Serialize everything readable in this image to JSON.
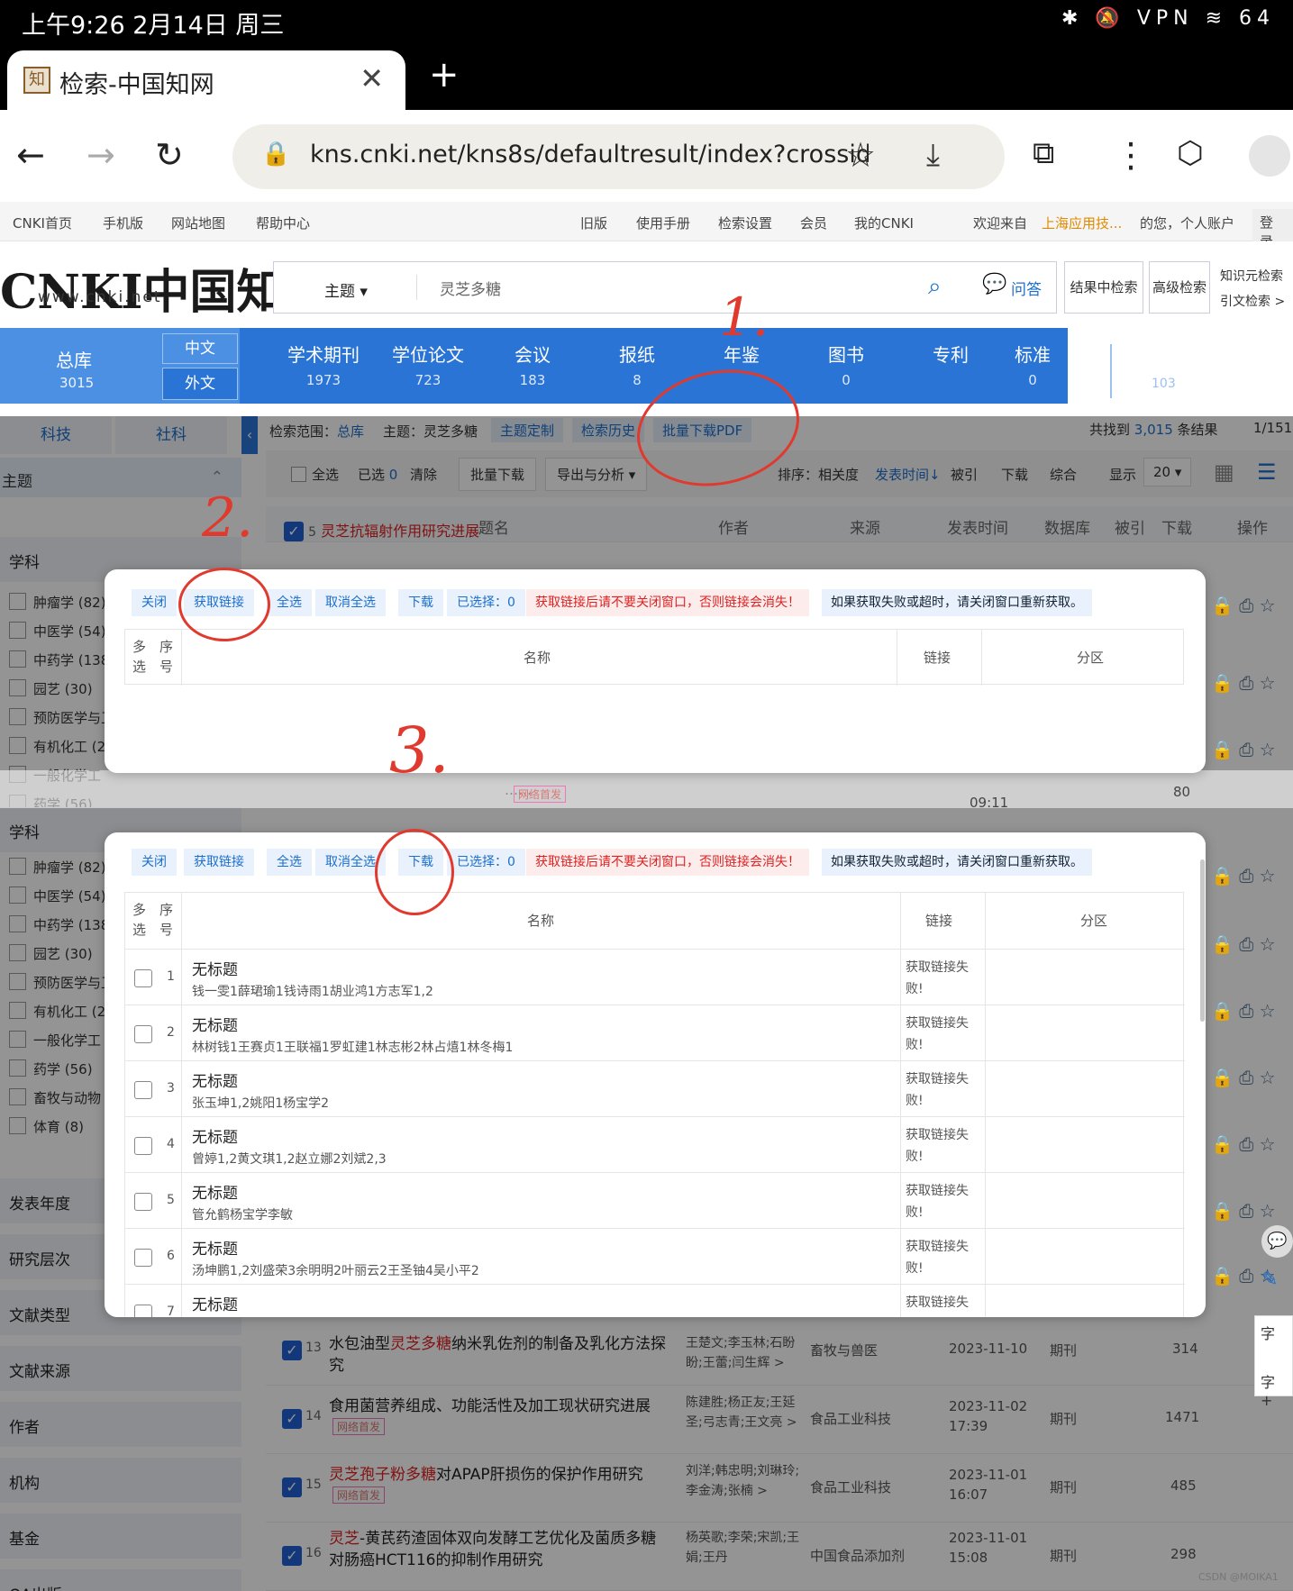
{
  "status": {
    "time": "上午9:26 2月14日 周三",
    "icons": "✱ 🔕 VPN ≋ 64"
  },
  "browser": {
    "tab_title": "检索-中国知网",
    "tab_favicon": "知",
    "url": "kns.cnki.net/kns8s/defaultresult/index?crossid"
  },
  "topnav": {
    "left": [
      "CNKI首页",
      "手机版",
      "网站地图",
      "帮助中心"
    ],
    "right": [
      "旧版",
      "使用手册",
      "检索设置",
      "会员",
      "我的CNKI"
    ],
    "welcome": "欢迎来自",
    "org": "上海应用技...",
    "account": "的您，个人账户",
    "login": "登录"
  },
  "search": {
    "logo": "CNKI中国知网",
    "logo_sub": "www.cnki.net",
    "field": "主题",
    "query": "灵芝多糖",
    "ask": "问答",
    "in_result": "结果中检索",
    "advanced": "高级检索",
    "knowledge": "知识元检索",
    "citation": "引文检索 >"
  },
  "dbtabs": {
    "all": {
      "label": "总库",
      "count": "3015",
      "cn": "中文",
      "en": "外文"
    },
    "items": [
      {
        "label": "学术期刊",
        "count": "1973"
      },
      {
        "label": "学位论文",
        "count": "723"
      },
      {
        "label": "会议",
        "count": "183"
      },
      {
        "label": "报纸",
        "count": "8"
      },
      {
        "label": "年鉴",
        "count": ""
      },
      {
        "label": "图书",
        "count": "0"
      },
      {
        "label": "专利",
        "count": ""
      },
      {
        "label": "标准",
        "count": "0"
      }
    ],
    "extra": "103"
  },
  "facets": {
    "tab1": "科技",
    "tab2": "社科",
    "topic": "主题",
    "subject": "学科",
    "subjects": [
      "肿瘤学 (82)",
      "中医学 (54)",
      "中药学 (138)",
      "园艺 (30)",
      "预防医学与卫生学",
      "有机化工 (2",
      "一般化学工",
      "药学 (56)",
      "畜牧与动物",
      "体育 (8)"
    ],
    "groups": [
      "发表年度",
      "研究层次",
      "文献类型",
      "文献来源",
      "作者",
      "机构",
      "基金",
      "OA出版"
    ]
  },
  "results": {
    "scope_label": "检索范围：",
    "scope": "总库",
    "topic_label": "主题：灵芝多糖",
    "pills": [
      "主题定制",
      "检索历史",
      "批量下载PDF"
    ],
    "found": "共找到",
    "total": "3,015",
    "found_suffix": "条结果",
    "page": "1/151",
    "selectall": "全选",
    "selected": "已选",
    "selected_n": "0",
    "clear": "清除",
    "batch": "批量下载",
    "export": "导出与分析",
    "sort": "排序：相关度",
    "sort_time": "发表时间",
    "sort_cited": "被引",
    "sort_dl": "下载",
    "sort_all": "综合",
    "show": "显示",
    "per_page": "20",
    "headers": [
      "题名",
      "作者",
      "来源",
      "发表时间",
      "数据库",
      "被引",
      "下载",
      "操作"
    ],
    "row5_title": "灵芝抗辐射作用研究进展",
    "rows": [
      {
        "n": "13",
        "title_a": "水包油型",
        "hl": "灵芝多糖",
        "title_b": "纳米乳佐剂的制备及乳化方法探究",
        "authors": "王楚文;李玉林;石盼盼;王蕾;闫生辉 >",
        "src": "畜牧与兽医",
        "date": "2023-11-10",
        "db": "期刊",
        "dl": "314",
        "tag": ""
      },
      {
        "n": "14",
        "title_a": "食用菌营养组成、功能活性及加工现状研究进展",
        "hl": "",
        "title_b": "",
        "authors": "陈建胜;杨正友;王延圣;弓志青;王文亮 >",
        "src": "食品工业科技",
        "date": "2023-11-02 17:39",
        "db": "期刊",
        "dl": "1471",
        "tag": "网络首发"
      },
      {
        "n": "15",
        "title_a": "",
        "hl": "灵芝孢子粉多糖",
        "title_b": "对APAP肝损伤的保护作用研究",
        "authors": "刘洋;韩忠明;刘琳玲;李金涛;张楠 >",
        "src": "食品工业科技",
        "date": "2023-11-01 16:07",
        "db": "期刊",
        "dl": "485",
        "tag": "网络首发"
      },
      {
        "n": "16",
        "title_a": "",
        "hl": "灵芝",
        "title_b": "-黄芪药渣固体双向发酵工艺优化及菌质多糖对肠癌HCT116的抑制作用研究",
        "authors": "杨英歌;李荣;宋凯;王娟;王丹",
        "src": "中国食品添加剂",
        "date": "2023-11-01 15:08",
        "db": "期刊",
        "dl": "298",
        "tag": ""
      }
    ],
    "mid_time": "09:11",
    "mid_num": "80",
    "mid_tag": "网络首发"
  },
  "modal": {
    "buttons": [
      "关闭",
      "获取链接",
      "全选",
      "取消全选",
      "下载",
      "已选择：0"
    ],
    "warn": "获取链接后请不要关闭窗口，否则链接会消失！",
    "info": "如果获取失败或超时，请关闭窗口重新获取。",
    "h_multi": "多选",
    "h_no": "序号",
    "h_name": "名称",
    "h_link": "链接",
    "h_zone": "分区",
    "rows": [
      {
        "no": "1",
        "title": "无标题",
        "authors": "钱一雯1薛珺瑜1钱诗雨1胡业鸿1方志军1,2",
        "link": "获取链接失败!"
      },
      {
        "no": "2",
        "title": "无标题",
        "authors": "林树钱1王赛贞1王联福1罗虹建1林志彬2林占熺1林冬梅1",
        "link": "获取链接失败!"
      },
      {
        "no": "3",
        "title": "无标题",
        "authors": "张玉坤1,2姚阳1杨宝学2",
        "link": "获取链接失败!"
      },
      {
        "no": "4",
        "title": "无标题",
        "authors": "曾婷1,2黄文琪1,2赵立娜2刘斌2,3",
        "link": "获取链接失败!"
      },
      {
        "no": "5",
        "title": "无标题",
        "authors": "管允鹤杨宝学李敏",
        "link": "获取链接失败!"
      },
      {
        "no": "6",
        "title": "无标题",
        "authors": "汤坤鹏1,2刘盛荣3余明明2叶丽云2王圣铀4吴小平2",
        "link": "获取链接失败!"
      },
      {
        "no": "7",
        "title": "无标题",
        "authors": "",
        "link": "获取链接失"
      }
    ]
  },
  "annotations": [
    "1.",
    "2.",
    "3."
  ],
  "watermark": "CSDN @MOIKA1",
  "side_tools": [
    "字",
    "字+"
  ],
  "colors": {
    "accent": "#2a74d6",
    "highlight": "#d22",
    "annotation": "#e03a2e"
  }
}
